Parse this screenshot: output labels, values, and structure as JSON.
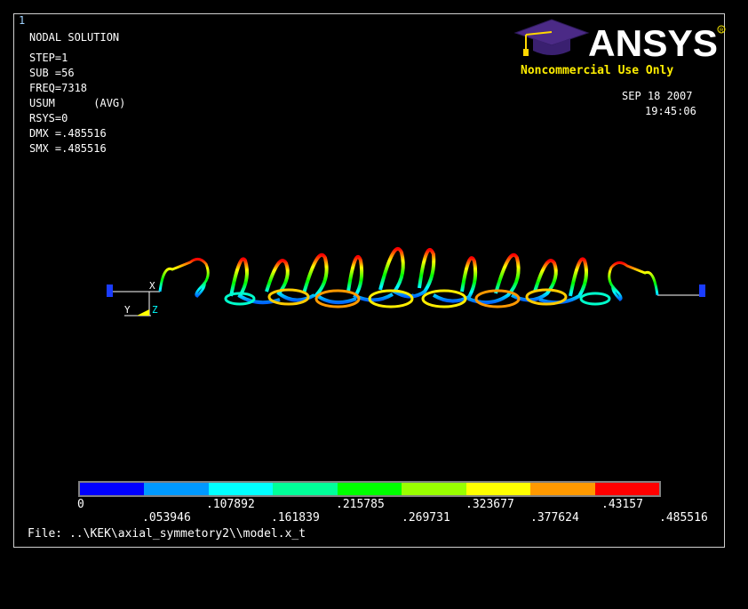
{
  "window_number": "1",
  "info": {
    "title": "NODAL SOLUTION",
    "step": "STEP=1",
    "sub": "SUB =56",
    "freq": "FREQ=7318",
    "usum": "USUM      (AVG)",
    "rsys": "RSYS=0",
    "dmx": "DMX =.485516",
    "smx": "SMX =.485516"
  },
  "brand": {
    "logo_text": "ANSYS",
    "registered": "R",
    "noncommercial": "Noncommercial Use Only"
  },
  "timestamp": {
    "date": "SEP 18 2007",
    "time": "19:45:06"
  },
  "axes": {
    "y": "Y",
    "z": "Z",
    "x": "X"
  },
  "legend": {
    "colors": [
      "#0000ff",
      "#0099ff",
      "#00ffff",
      "#00ff99",
      "#00ff00",
      "#99ff00",
      "#ffff00",
      "#ff9900",
      "#ff0000"
    ],
    "labels_row1": [
      "0",
      ".107892",
      ".215785",
      ".323677",
      ".43157"
    ],
    "labels_row2": [
      ".053946",
      ".161839",
      ".269731",
      ".377624",
      ".485516"
    ]
  },
  "file_label": "File: ..\\KEK\\axial_symmetory2\\\\model.x_t"
}
